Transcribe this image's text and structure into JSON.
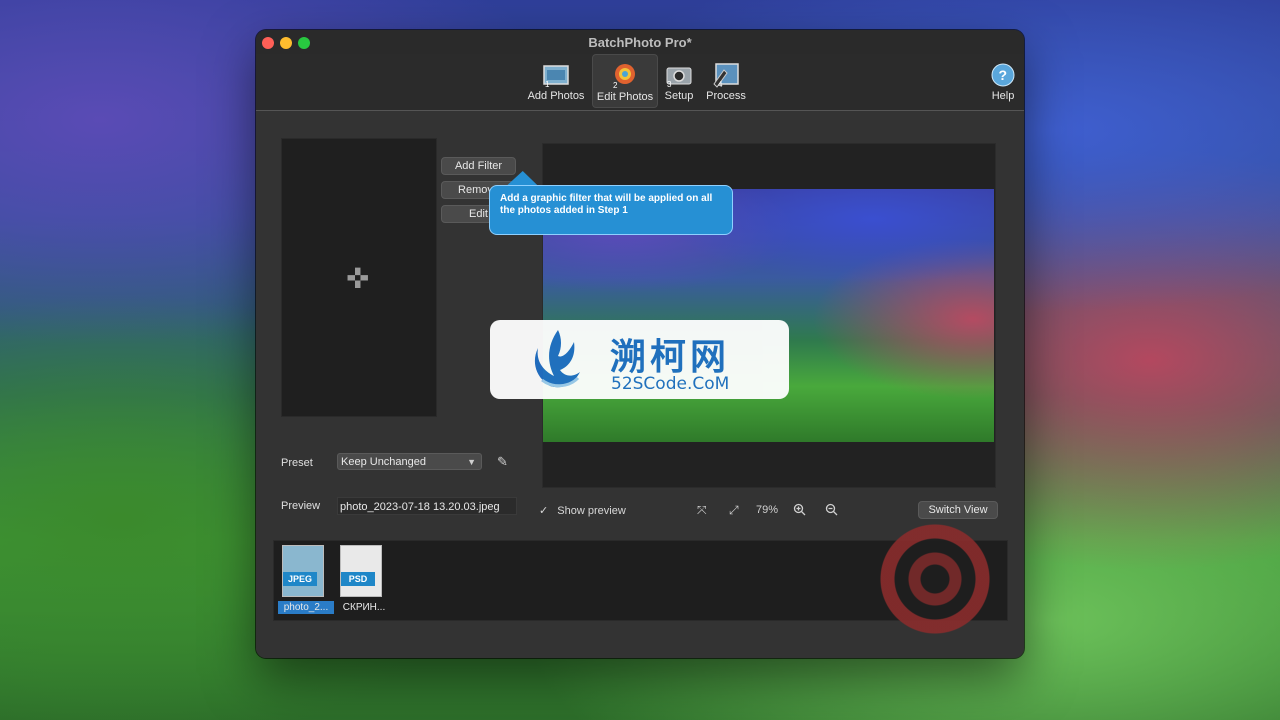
{
  "window": {
    "title": "BatchPhoto Pro*"
  },
  "toolbar": {
    "items": [
      {
        "label": "Add Photos",
        "step": "1"
      },
      {
        "label": "Edit Photos",
        "step": "2"
      },
      {
        "label": "Setup",
        "step": "3"
      },
      {
        "label": "Process",
        "step": "4"
      }
    ],
    "help_label": "Help"
  },
  "filters": {
    "add_label": "Add Filter",
    "remove_label": "Remove",
    "edit_label": "Edit",
    "tooltip": "Add a graphic filter that will be applied on all the photos added in Step 1"
  },
  "watermark": {
    "chinese": "溯柯网",
    "english": "52SCode.CoM"
  },
  "preset": {
    "label": "Preset",
    "value": "Keep Unchanged"
  },
  "preview": {
    "label": "Preview",
    "file": "photo_2023-07-18 13.20.03.jpeg",
    "show_preview_label": "Show preview",
    "show_preview_checked": true,
    "zoom": "79%",
    "switch_view_label": "Switch View"
  },
  "thumbnails": [
    {
      "badge": "JPEG",
      "label": "photo_2...",
      "selected": true
    },
    {
      "badge": "PSD",
      "label": "СКРИН...",
      "selected": false
    }
  ],
  "colors": {
    "accent": "#2690d4",
    "window_bg": "#333333",
    "selection": "#2a7cc7"
  }
}
